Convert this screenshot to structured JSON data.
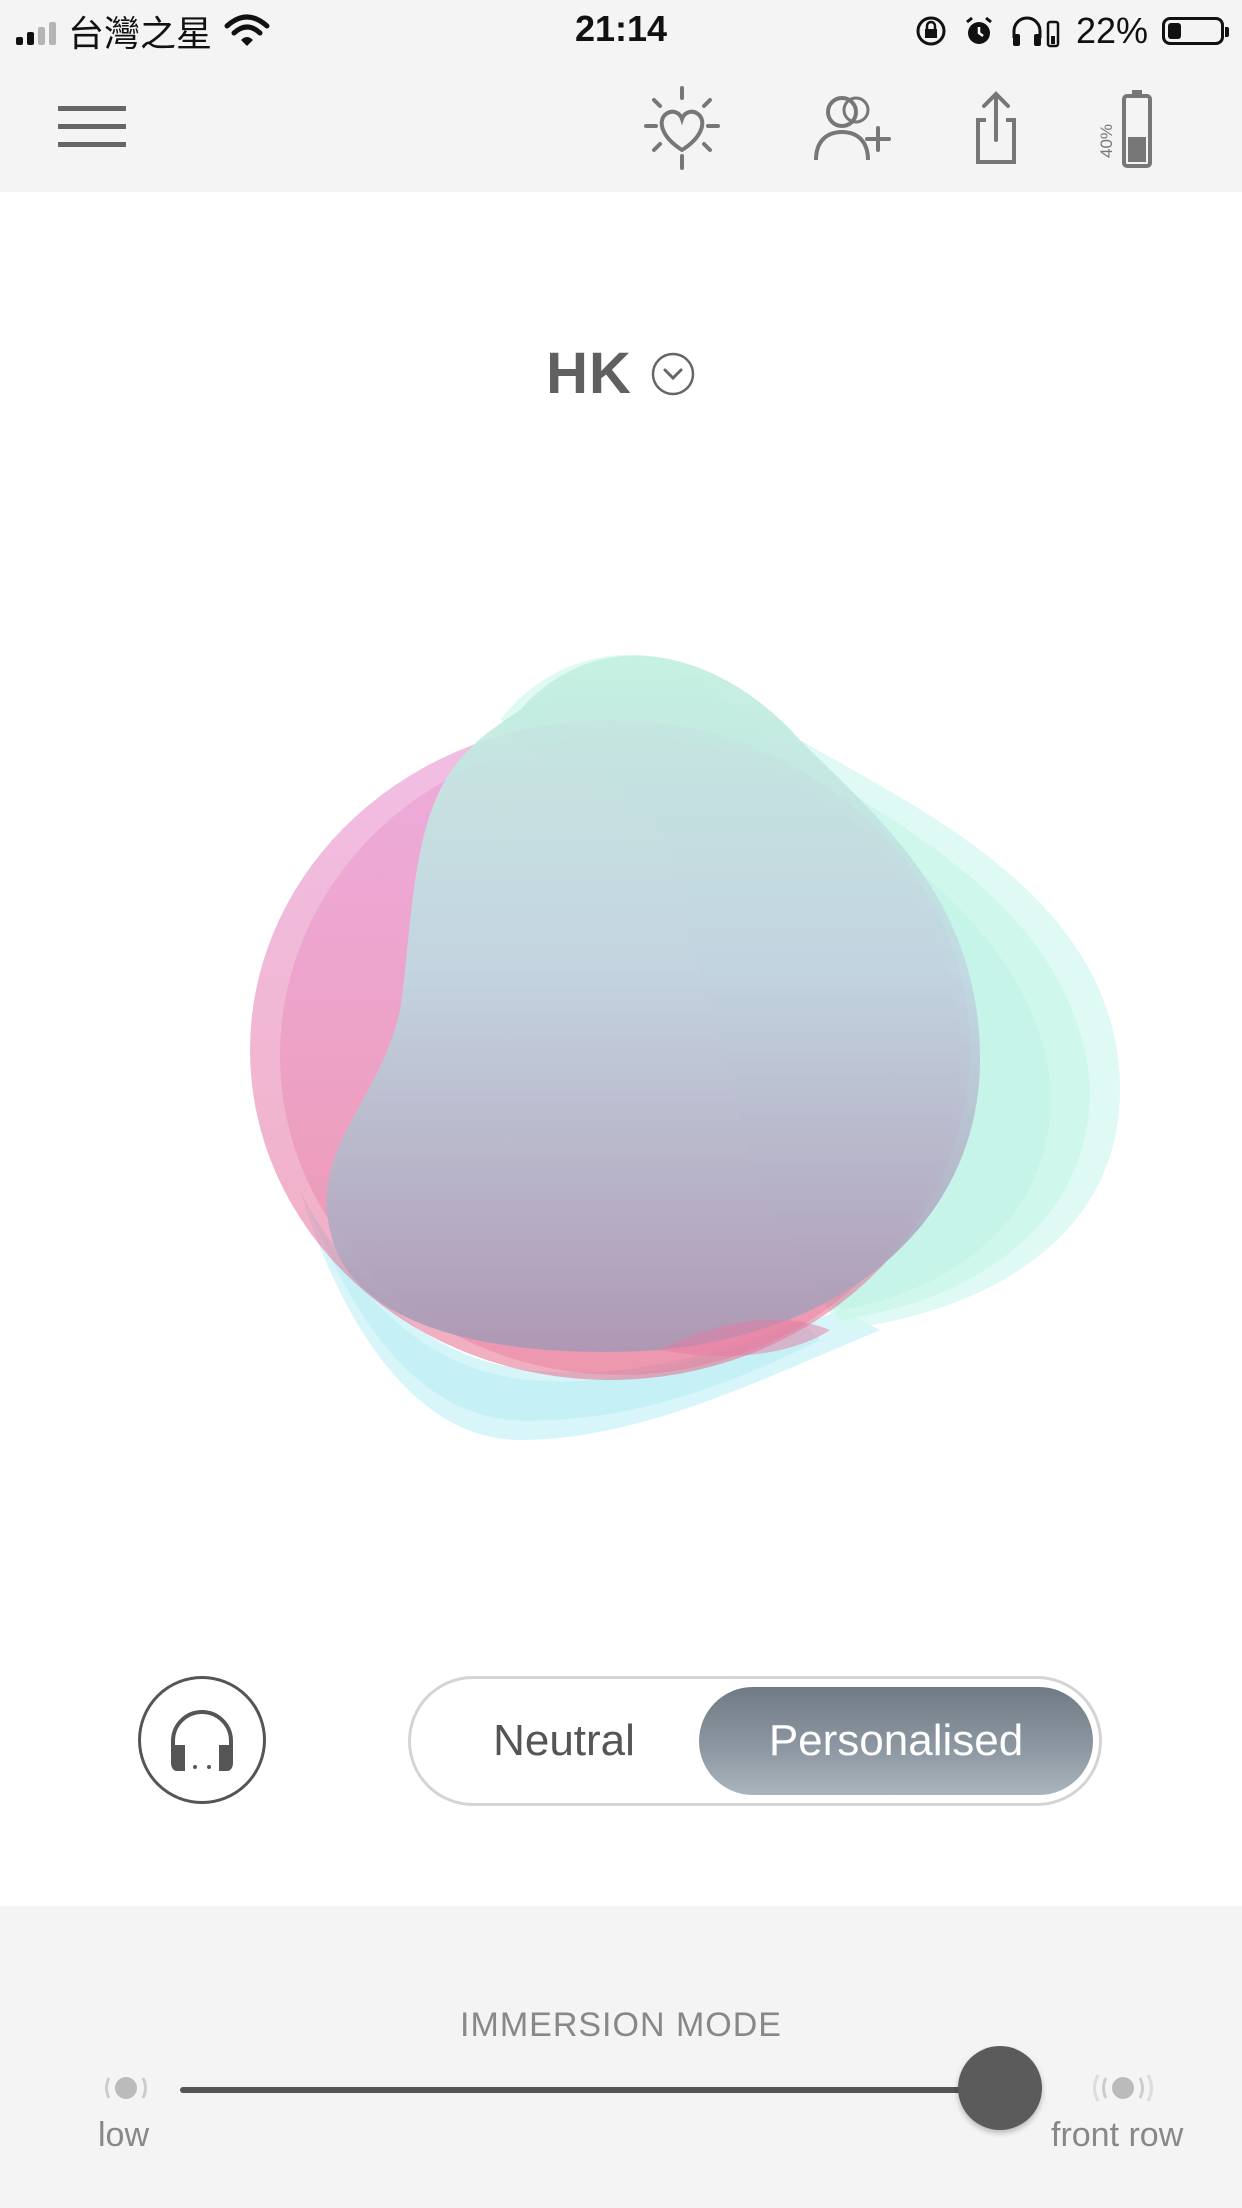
{
  "status_bar": {
    "carrier": "台灣之星",
    "time": "21:14",
    "battery_percent": "22%",
    "battery_level": 0.22
  },
  "header": {
    "device_battery_label": "40%",
    "device_battery_level": 0.4
  },
  "profile": {
    "name": "HK"
  },
  "sound_mode": {
    "options": [
      "Neutral",
      "Personalised"
    ],
    "selected": "Personalised"
  },
  "immersion": {
    "title": "IMMERSION MODE",
    "low_label": "low",
    "high_label": "front row",
    "level": 1.0
  },
  "colors": {
    "accent_dark": "#5b5b5b",
    "blob_pink": "#e06aa8",
    "blob_mint": "#b8f2dc",
    "blob_cyan": "#bff0f5"
  }
}
